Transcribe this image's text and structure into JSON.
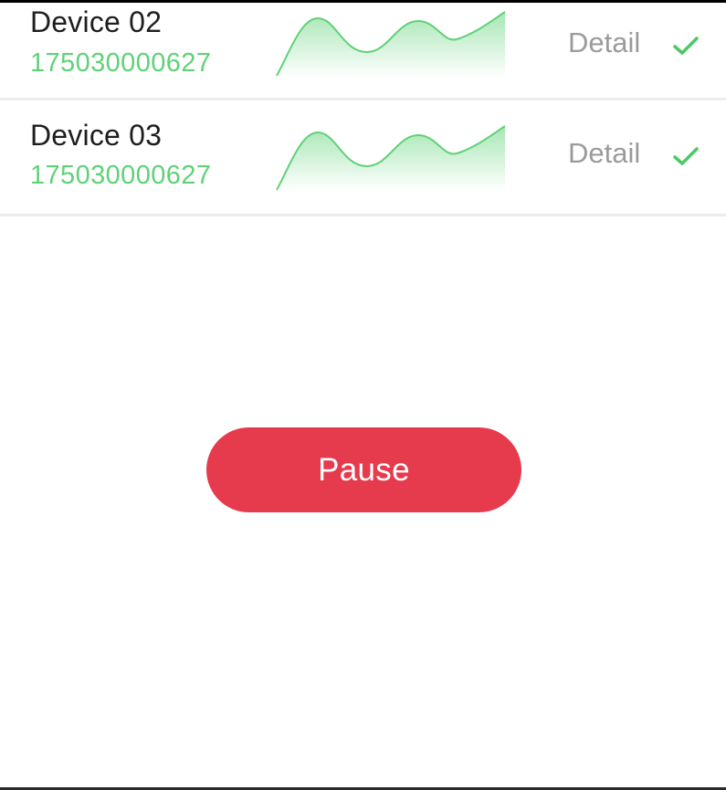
{
  "devices": [
    {
      "name": "Device 02",
      "serial": "175030000627",
      "detail_label": "Detail",
      "status_icon": "check-icon",
      "status_color": "#4cc864"
    },
    {
      "name": "Device 03",
      "serial": "175030000627",
      "detail_label": "Detail",
      "status_icon": "check-icon",
      "status_color": "#4cc864"
    }
  ],
  "pause_button": {
    "label": "Pause"
  },
  "colors": {
    "accent_green": "#5fd277",
    "pause_red": "#e63a4d",
    "detail_gray": "#9b9b9b"
  }
}
